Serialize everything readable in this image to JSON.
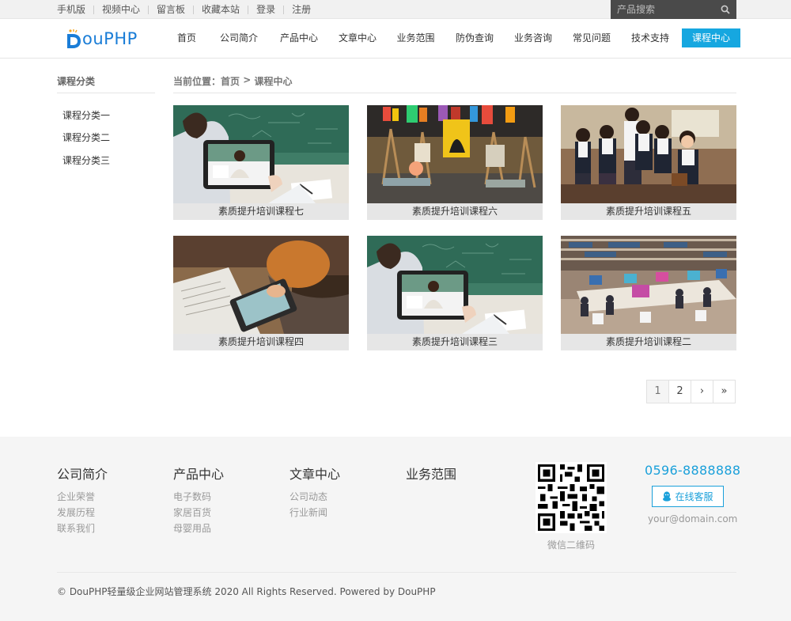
{
  "topbar": {
    "links": [
      "手机版",
      "视频中心",
      "留言板",
      "收藏本站",
      "登录",
      "注册"
    ],
    "search_placeholder": "产品搜索"
  },
  "header": {
    "logo_text": "ouPHP",
    "logo_letter": "D",
    "nav": [
      "首页",
      "公司简介",
      "产品中心",
      "文章中心",
      "业务范围",
      "防伪查询",
      "业务咨询",
      "常见问题",
      "技术支持",
      "课程中心"
    ],
    "active_index": 9
  },
  "sidebar": {
    "title": "课程分类",
    "items": [
      "课程分类一",
      "课程分类二",
      "课程分类三"
    ]
  },
  "breadcrumb": {
    "label": "当前位置：",
    "home": "首页",
    "sep": " > ",
    "current": "课程中心"
  },
  "courses": [
    {
      "title": "素质提升培训课程七",
      "image": "tablet-video-lesson"
    },
    {
      "title": "素质提升培训课程六",
      "image": "art-studio-easels"
    },
    {
      "title": "素质提升培训课程五",
      "image": "students-reading"
    },
    {
      "title": "素质提升培训课程四",
      "image": "child-with-tablet"
    },
    {
      "title": "素质提升培训课程三",
      "image": "tablet-video-lesson"
    },
    {
      "title": "素质提升培训课程二",
      "image": "computer-library"
    }
  ],
  "pager": {
    "pages": [
      "1",
      "2"
    ],
    "next": "›",
    "last": "»",
    "current": "1"
  },
  "footer": {
    "columns": [
      {
        "title": "公司简介",
        "links": [
          "企业荣誉",
          "发展历程",
          "联系我们"
        ]
      },
      {
        "title": "产品中心",
        "links": [
          "电子数码",
          "家居百货",
          "母婴用品"
        ]
      },
      {
        "title": "文章中心",
        "links": [
          "公司动态",
          "行业新闻"
        ]
      },
      {
        "title": "业务范围",
        "links": []
      }
    ],
    "qr_label": "微信二维码",
    "phone": "0596-8888888",
    "kefu_label": "在线客服",
    "email": "your@domain.com",
    "copyright": "© DouPHP轻量级企业网站管理系统 2020 All Rights Reserved. Powered by DouPHP"
  },
  "colors": {
    "accent": "#16a7e0",
    "logo": "#1a7dd7"
  }
}
